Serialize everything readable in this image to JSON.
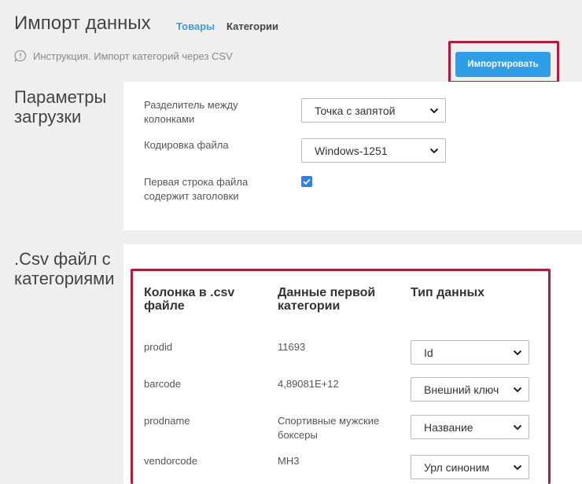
{
  "header": {
    "title": "Импорт данных",
    "tabs": [
      {
        "label": "Товары"
      },
      {
        "label": "Категории"
      }
    ],
    "instruction": "Инструкция. Импорт категорий через CSV",
    "import_button": "Импортировать"
  },
  "params": {
    "title": "Параметры загрузки",
    "separator_label": "Разделитель между колонками",
    "separator_value": "Точка с запятой",
    "encoding_label": "Кодировка файла",
    "encoding_value": "Windows-1251",
    "header_row_label": "Первая строка файла содержит заголовки",
    "header_row_checked": true
  },
  "csv": {
    "title": ".Csv файл с категориями",
    "columns": [
      "Колонка в .csv файле",
      "Данные первой категории",
      "Тип данных"
    ],
    "rows": [
      {
        "column": "prodid",
        "data": "11693",
        "type": "Id"
      },
      {
        "column": "barcode",
        "data": "4,89081E+12",
        "type": "Внешний ключ"
      },
      {
        "column": "prodname",
        "data": "Спортивные мужские боксеры",
        "type": "Название"
      },
      {
        "column": "vendorcode",
        "data": "MH3",
        "type": "Урл синоним"
      }
    ]
  },
  "colors": {
    "accent": "#2f9ee8",
    "highlight": "#b01c3c",
    "arrow": "#a51a36"
  }
}
